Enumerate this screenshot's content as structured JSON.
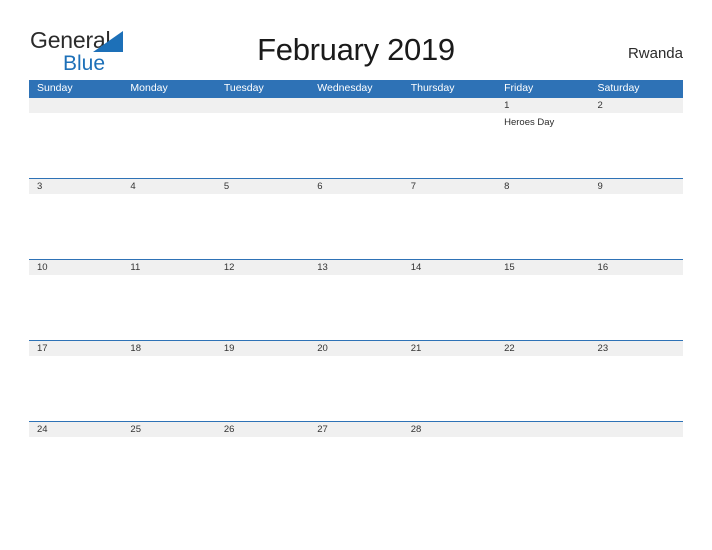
{
  "brand": {
    "name_part1": "General",
    "name_part2": "Blue",
    "flag_icon": "triangle-flag-icon",
    "color_blue": "#1d70b8",
    "color_dark": "#2b2b2b"
  },
  "header": {
    "title": "February 2019",
    "region": "Rwanda"
  },
  "theme": {
    "header_blue": "#2e72b6",
    "day_band_gray": "#f0f0f0",
    "page_background": "#ffffff"
  },
  "calendar": {
    "month": "February",
    "year": "2019",
    "weekday_headers": [
      "Sunday",
      "Monday",
      "Tuesday",
      "Wednesday",
      "Thursday",
      "Friday",
      "Saturday"
    ],
    "weeks": [
      [
        {
          "day": "",
          "events": []
        },
        {
          "day": "",
          "events": []
        },
        {
          "day": "",
          "events": []
        },
        {
          "day": "",
          "events": []
        },
        {
          "day": "",
          "events": []
        },
        {
          "day": "1",
          "events": [
            "Heroes Day"
          ]
        },
        {
          "day": "2",
          "events": []
        }
      ],
      [
        {
          "day": "3",
          "events": []
        },
        {
          "day": "4",
          "events": []
        },
        {
          "day": "5",
          "events": []
        },
        {
          "day": "6",
          "events": []
        },
        {
          "day": "7",
          "events": []
        },
        {
          "day": "8",
          "events": []
        },
        {
          "day": "9",
          "events": []
        }
      ],
      [
        {
          "day": "10",
          "events": []
        },
        {
          "day": "11",
          "events": []
        },
        {
          "day": "12",
          "events": []
        },
        {
          "day": "13",
          "events": []
        },
        {
          "day": "14",
          "events": []
        },
        {
          "day": "15",
          "events": []
        },
        {
          "day": "16",
          "events": []
        }
      ],
      [
        {
          "day": "17",
          "events": []
        },
        {
          "day": "18",
          "events": []
        },
        {
          "day": "19",
          "events": []
        },
        {
          "day": "20",
          "events": []
        },
        {
          "day": "21",
          "events": []
        },
        {
          "day": "22",
          "events": []
        },
        {
          "day": "23",
          "events": []
        }
      ],
      [
        {
          "day": "24",
          "events": []
        },
        {
          "day": "25",
          "events": []
        },
        {
          "day": "26",
          "events": []
        },
        {
          "day": "27",
          "events": []
        },
        {
          "day": "28",
          "events": []
        },
        {
          "day": "",
          "events": []
        },
        {
          "day": "",
          "events": []
        }
      ]
    ]
  }
}
